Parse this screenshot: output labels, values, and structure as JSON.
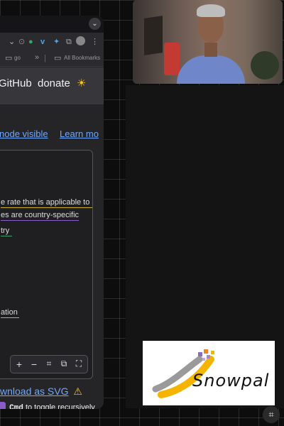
{
  "browser": {
    "dropdown_icon": "chevron-down-icon",
    "bookmarks": {
      "item1": "go",
      "overflow": "»",
      "all_bookmarks": "All Bookmarks"
    }
  },
  "site": {
    "nav": {
      "github": "GitHub",
      "donate": "donate"
    },
    "theme_icon": "sun-icon",
    "links": {
      "node_visible": "node visible",
      "learn_more": "Learn mo"
    }
  },
  "diagram": {
    "lines": [
      "e rate that is applicable to a",
      "es are country-specific",
      "try",
      "ation"
    ]
  },
  "zoom": {
    "plus": "+",
    "minus": "−"
  },
  "download": {
    "label": "wnload as SVG",
    "warning_icon": "⚠"
  },
  "toggle": {
    "key": "Cmd",
    "text": "to toggle recursively"
  },
  "logo": {
    "text": "Snowpal"
  }
}
